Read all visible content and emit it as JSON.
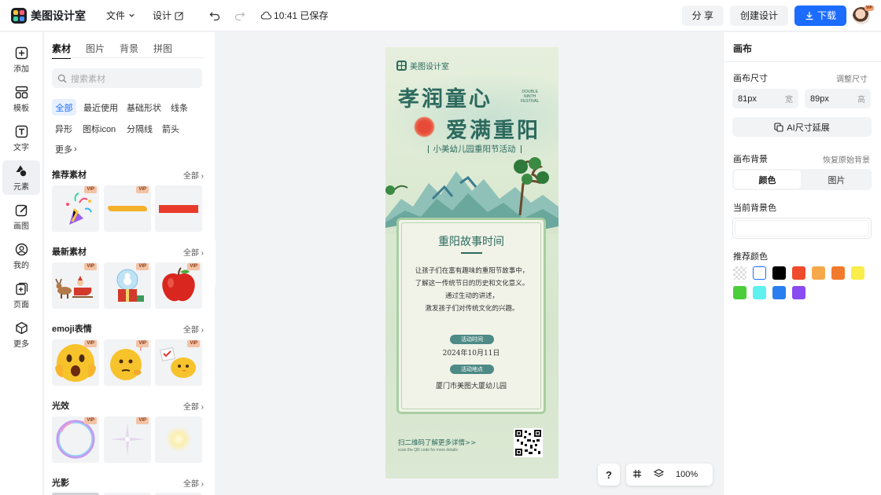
{
  "app": {
    "name": "美图设计室"
  },
  "topbar": {
    "file_menu": "文件",
    "design_menu": "设计",
    "save_status": "10:41 已保存",
    "share_label": "分 享",
    "create_label": "创建设计",
    "download_label": "下载",
    "vip_badge": "VIP"
  },
  "left_nav": [
    {
      "label": "添加",
      "icon": "plus-square-icon"
    },
    {
      "label": "模板",
      "icon": "template-icon"
    },
    {
      "label": "文字",
      "icon": "text-icon"
    },
    {
      "label": "元素",
      "icon": "shapes-icon"
    },
    {
      "label": "画图",
      "icon": "pen-icon"
    },
    {
      "label": "我的",
      "icon": "user-icon"
    },
    {
      "label": "页面",
      "icon": "page-add-icon"
    },
    {
      "label": "更多",
      "icon": "cube-icon"
    }
  ],
  "panel": {
    "tabs": [
      "素材",
      "图片",
      "背景",
      "拼图"
    ],
    "search_placeholder": "搜索素材",
    "chips": [
      "全部",
      "最近使用",
      "基础形状",
      "线条",
      "异形",
      "图标icon",
      "分隔线",
      "箭头",
      "更多"
    ],
    "sections": [
      {
        "title": "推荐素材",
        "all": "全部",
        "items": [
          "party-popper-sticker",
          "orange-brush-stroke",
          "red-rectangle"
        ]
      },
      {
        "title": "最新素材",
        "all": "全部",
        "items": [
          "reindeer-sleigh",
          "snowglobe-gift",
          "red-apple"
        ]
      },
      {
        "title": "emoji表情",
        "all": "全部",
        "items": [
          "shocked-emoji",
          "thinking-emoji",
          "chick-emoji"
        ]
      },
      {
        "title": "光效",
        "all": "全部",
        "items": [
          "bubble-ring",
          "star-sparkle",
          "soft-glow"
        ]
      },
      {
        "title": "光影",
        "all": "全部",
        "items": []
      }
    ],
    "vip_label": "VIP"
  },
  "poster": {
    "brand": "美图设计室",
    "title_line1": "孝润童心",
    "title_line2": "爱满重阳",
    "en_line1": "DOUBLE",
    "en_line2": "NINTH",
    "en_line3": "FESTIVAL",
    "subtitle": "小美幼儿园重阳节活动",
    "card_title": "重阳故事时间",
    "card_body": [
      "让孩子们在富有趣味的重阳节故事中，",
      "了解这一传统节日的历史和文化意义。",
      "通过生动的讲述，",
      "激发孩子们对传统文化的兴趣。"
    ],
    "time_label": "活动时间",
    "time_value": "2024年10月11日",
    "place_label": "活动地点",
    "place_value": "厦门市美图大厦幼儿园",
    "footer_line1": "扫二维码了解更多详情>>",
    "footer_line2": "scan the QR code for more details"
  },
  "right_panel": {
    "title": "画布",
    "size_label": "画布尺寸",
    "size_adjust": "调整尺寸",
    "width_value": "81px",
    "width_unit": "宽",
    "height_value": "89px",
    "height_unit": "高",
    "ai_extend": "AI尺寸延展",
    "bg_label": "画布背景",
    "bg_restore": "恢复原始背景",
    "bg_tabs": [
      "颜色",
      "图片"
    ],
    "current_bg_label": "当前背景色",
    "recommend_label": "推荐颜色",
    "colors": [
      "transparent",
      "#ffffff",
      "#000000",
      "#f04a2c",
      "#f5a94a",
      "#f27a2c",
      "#f8ed4a",
      "#4cce3b",
      "#5ff0f0",
      "#2a7ff0",
      "#8a4bf0"
    ]
  },
  "zoom": {
    "help": "?",
    "value": "100%"
  },
  "colors": {
    "accent": "#1b6cff",
    "poster_green": "#2d6a5e"
  }
}
